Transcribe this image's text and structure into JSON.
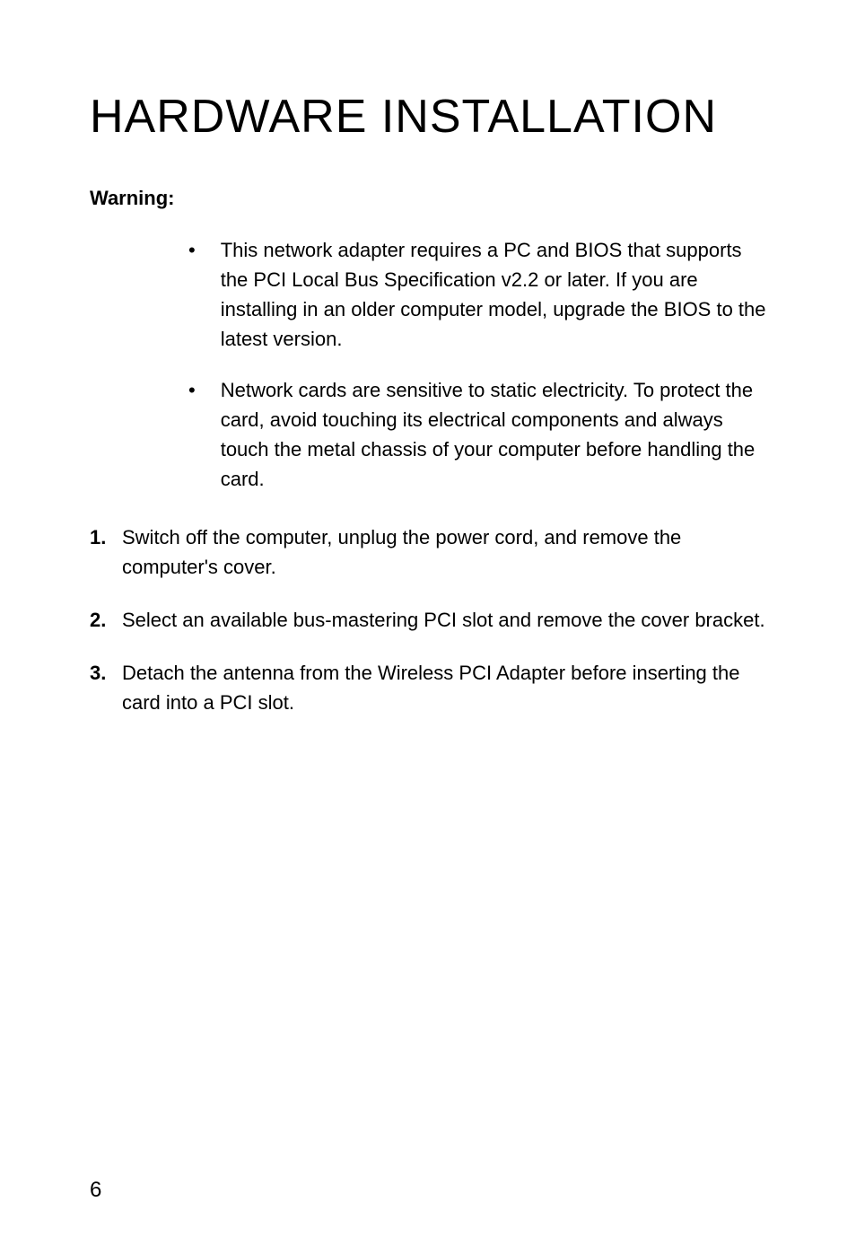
{
  "title": "HARDWARE INSTALLATION",
  "warning_label": "Warning:",
  "bullets": [
    {
      "text": "This network adapter requires a PC and BIOS that supports the PCI Local Bus Specification v2.2 or later. If you are installing in an older computer model, upgrade the BIOS to the latest version."
    },
    {
      "text": "Network cards are sensitive to static electricity. To protect the card, avoid touching its electrical components and always touch the metal chassis of your computer before handling the card."
    }
  ],
  "steps": [
    {
      "number": "1.",
      "text": "Switch off the computer, unplug the power cord, and remove the computer's cover."
    },
    {
      "number": "2.",
      "text": "Select an available bus-mastering PCI slot and remove the cover bracket."
    },
    {
      "number": "3.",
      "text": "Detach the antenna from the Wireless PCI Adapter before inserting the card into a PCI slot."
    }
  ],
  "page_number": "6"
}
